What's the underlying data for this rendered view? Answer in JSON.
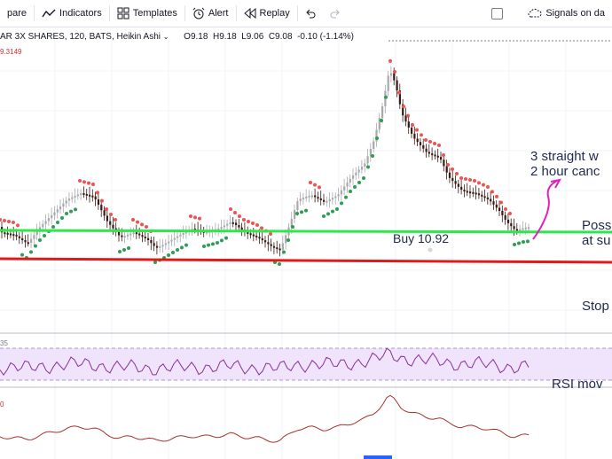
{
  "toolbar": {
    "compare_label": "pare",
    "indicators_label": "Indicators",
    "templates_label": "Templates",
    "alert_label": "Alert",
    "replay_label": "Replay",
    "signals_label": "Signals on da"
  },
  "legend": {
    "symbol": "AR 3X SHARES, 120, BATS, Heikin Ashi",
    "open": "O9.18",
    "high": "H9.18",
    "low": "L9.06",
    "close": "C9.08",
    "change": "-0.10 (-1.14%)"
  },
  "price_tag": "9.3149",
  "annotations": {
    "buy": "Buy 10.92",
    "note_line1": "3 straight w",
    "note_line2": "2 hour canc",
    "possible_line1": "Poss",
    "possible_line2": "at su",
    "stop": "Stop",
    "rsi_note": "RSI mov"
  },
  "rsi_label": "35",
  "indicator_label": "0",
  "colors": {
    "support_line": "#2ee84a",
    "stop_line": "#e01919",
    "arrow": "#e61fbf",
    "rsi_band": "#efe4fb",
    "rsi_line": "#8a2e9e",
    "indicator_line": "#a8322a",
    "candle_up": "#a7a9ad",
    "candle_down": "#3a1a14",
    "trail_up": "#2e9e53",
    "trail_down": "#f05252"
  }
}
